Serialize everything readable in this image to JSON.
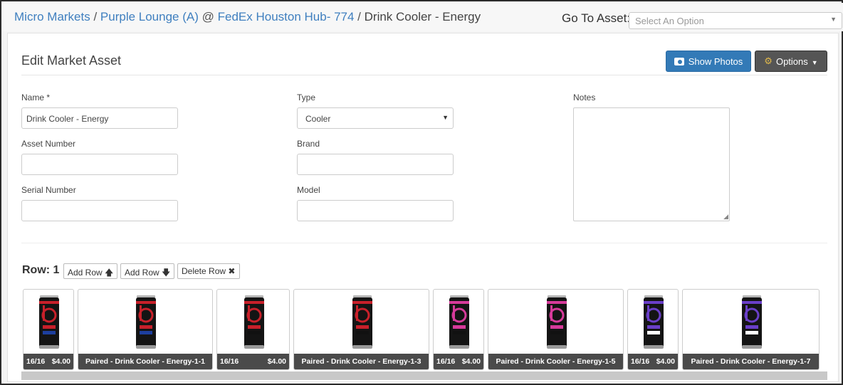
{
  "breadcrumb": {
    "items": [
      "Micro Markets",
      "Purple Lounge (A)",
      "FedEx Houston Hub- 774"
    ],
    "sep1": " / ",
    "sep2": " @ ",
    "sep3": " / ",
    "current": "Drink Cooler - Energy"
  },
  "goto": {
    "label": "Go To Asset:",
    "placeholder": "Select An Option"
  },
  "panel": {
    "title": "Edit Market Asset",
    "show_photos": "Show Photos",
    "options": "Options"
  },
  "form": {
    "name_label": "Name *",
    "name_value": "Drink Cooler - Energy",
    "asset_number_label": "Asset Number",
    "asset_number_value": "",
    "serial_label": "Serial Number",
    "serial_value": "",
    "type_label": "Type",
    "type_value": "Cooler",
    "brand_label": "Brand",
    "brand_value": "",
    "model_label": "Model",
    "model_value": "",
    "notes_label": "Notes",
    "notes_value": ""
  },
  "row": {
    "label": "Row: 1",
    "add_row_up": "Add Row",
    "add_row_down": "Add Row",
    "delete_row": "Delete Row"
  },
  "slots": [
    {
      "kind": "product",
      "count": "16/16",
      "price": "$4.00",
      "can_color": "#c8202a",
      "accent": "#1d3f9e"
    },
    {
      "kind": "paired",
      "label": "Paired - Drink Cooler - Energy-1-1",
      "can_color": "#c8202a",
      "accent": "#1d3f9e"
    },
    {
      "kind": "product",
      "count": "16/16",
      "price": "$4.00",
      "can_color": "#c8202a",
      "accent": "#111111"
    },
    {
      "kind": "paired",
      "label": "Paired - Drink Cooler - Energy-1-3",
      "can_color": "#c8202a",
      "accent": "#111111"
    },
    {
      "kind": "product",
      "count": "16/16",
      "price": "$4.00",
      "can_color": "#d63a9a",
      "accent": "#111111"
    },
    {
      "kind": "paired",
      "label": "Paired - Drink Cooler - Energy-1-5",
      "can_color": "#d63a9a",
      "accent": "#111111"
    },
    {
      "kind": "product",
      "count": "16/16",
      "price": "$4.00",
      "can_color": "#6a3fc8",
      "accent": "#ffffff"
    },
    {
      "kind": "paired",
      "label": "Paired - Drink Cooler - Energy-1-7",
      "can_color": "#6a3fc8",
      "accent": "#ffffff"
    }
  ]
}
